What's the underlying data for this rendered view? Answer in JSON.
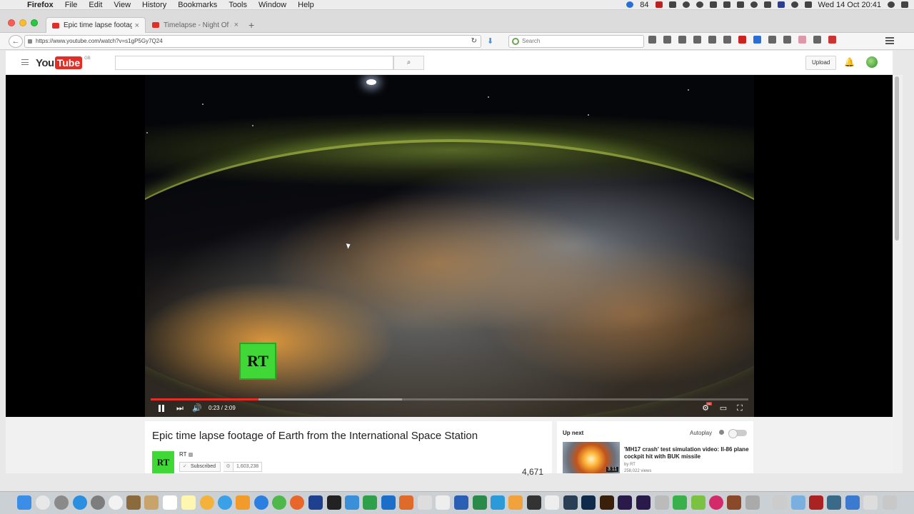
{
  "menubar": {
    "apple": "",
    "items": [
      "Firefox",
      "File",
      "Edit",
      "View",
      "History",
      "Bookmarks",
      "Tools",
      "Window",
      "Help"
    ],
    "status_count": "84",
    "clock": "Wed 14 Oct  20:41"
  },
  "browser": {
    "tabs": [
      {
        "title": "Epic time lapse footage of ..."
      },
      {
        "title": "Timelapse - Night Of SEOU..."
      }
    ],
    "new_tab": "+",
    "url": "https://www.youtube.com/watch?v=s1gP5Gy7Q24",
    "search_placeholder": "Search"
  },
  "youtube": {
    "logo_you": "You",
    "logo_tube": "Tube",
    "region": "GB",
    "upload_label": "Upload"
  },
  "player": {
    "current_time": "0:23",
    "duration": "2:09",
    "time_display": "0:23 / 2:09",
    "progress_fraction": 0.18,
    "buffered_fraction": 0.42,
    "watermark": "RT"
  },
  "video": {
    "title": "Epic time lapse footage of Earth from the International Space Station",
    "channel_logo": "RT",
    "channel_name": "RT",
    "subscribed_label": "Subscribed",
    "subscriber_count": "1,603,238",
    "view_count": "4,671"
  },
  "up_next": {
    "label": "Up next",
    "autoplay_label": "Autoplay",
    "autoplay_on": false,
    "item": {
      "title": "'MH17 crash' test simulation video: Il-86 plane cockpit hit with BUK missile",
      "channel": "by RT",
      "views": "258,022 views",
      "duration": "3:11"
    }
  },
  "colors": {
    "youtube_red": "#e52d27",
    "rt_green": "#3fd836",
    "toolbar_bg": "#f5f5f5"
  },
  "icons": [
    "apple-icon",
    "back-icon",
    "lock-icon",
    "reload-icon",
    "search-icon",
    "bell-icon",
    "avatar-icon",
    "pause-icon",
    "next-icon",
    "volume-icon",
    "settings-icon",
    "theater-icon",
    "fullscreen-icon"
  ]
}
